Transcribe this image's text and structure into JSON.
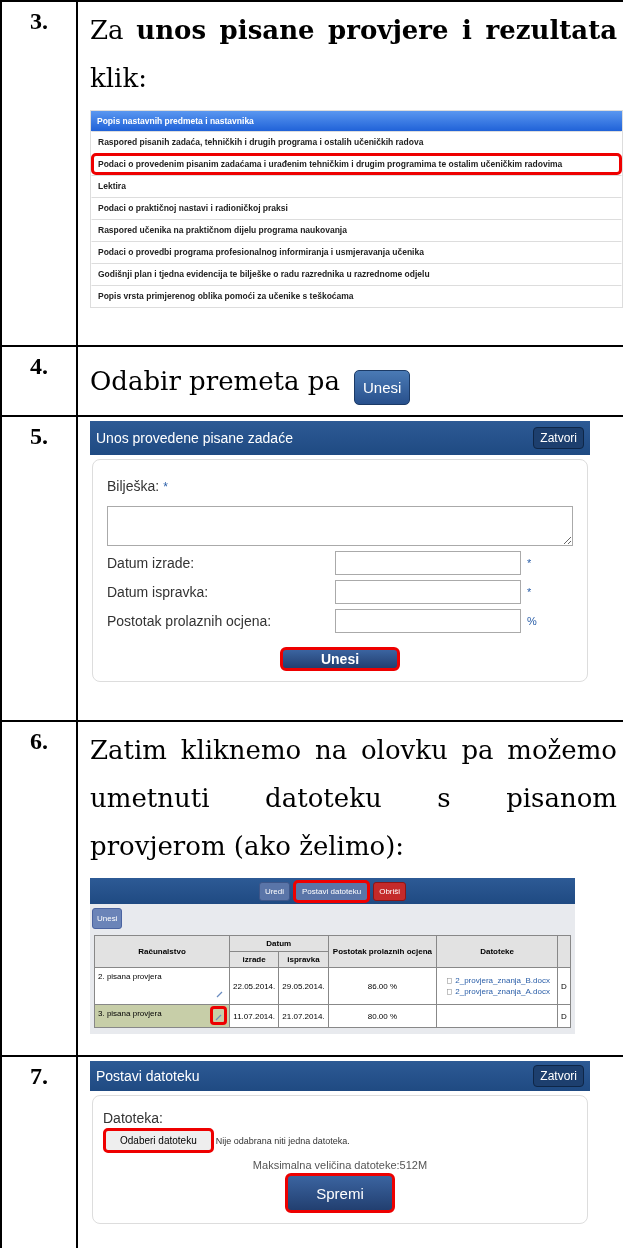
{
  "steps": [
    {
      "number": "3.",
      "kind": "menu",
      "text": "Za **unos pisane provjere i rezultata** klik:",
      "menu": {
        "header": "Popis nastavnih predmeta i nastavnika",
        "items": [
          {
            "label": "Raspored pisanih zadaća, tehničkih i drugih programa i ostalih učeničkih radova",
            "highlighted": false
          },
          {
            "label": "Podaci o provedenim pisanim zadaćama i urađenim tehničkim i drugim programima te ostalim učeničkim radovima",
            "highlighted": true
          },
          {
            "label": "Lektira",
            "highlighted": false
          },
          {
            "label": "Podaci o praktičnoj nastavi i radioničkoj praksi",
            "highlighted": false
          },
          {
            "label": "Raspored učenika na praktičnom dijelu programa naukovanja",
            "highlighted": false
          },
          {
            "label": "Podaci o provedbi programa profesionalnog informiranja i usmjeravanja učenika",
            "highlighted": false
          },
          {
            "label": "Godišnji plan i tjedna evidencija te bilješke o radu razrednika u razrednome odjelu",
            "highlighted": false
          },
          {
            "label": "Popis vrsta primjerenog oblika pomoći za učenike s teškoćama",
            "highlighted": false
          }
        ]
      }
    },
    {
      "number": "4.",
      "kind": "button",
      "text": "Odabir premeta pa",
      "button": "Unesi"
    },
    {
      "number": "5.",
      "kind": "form",
      "dialog": {
        "title": "Unos provedene pisane zadaće",
        "close": "Zatvori",
        "note_label": "Bilješka:",
        "note_mark": "*",
        "fields": [
          {
            "label": "Datum izrade:",
            "suffix": "*"
          },
          {
            "label": "Datum ispravka:",
            "suffix": "*"
          },
          {
            "label": "Postotak prolaznih ocjena:",
            "suffix": "%"
          }
        ],
        "submit": {
          "label": "Unesi",
          "highlighted": true
        }
      }
    },
    {
      "number": "6.",
      "kind": "grid",
      "text": "Zatim kliknemo na olovku pa možemo umetnuti datoteku s pisanom provjerom (ako želimo):",
      "toolbar": [
        {
          "label": "Uredi",
          "kind": "normal",
          "highlighted": false
        },
        {
          "label": "Postavi datoteku",
          "kind": "normal",
          "highlighted": true
        },
        {
          "label": "Obriši",
          "kind": "danger",
          "highlighted": false
        }
      ],
      "add_button": "Unesi",
      "table": {
        "columns": [
          "Računalstvo",
          "Datum",
          "Postotak prolaznih ocjena",
          "Datoteke"
        ],
        "subcolumns": [
          "izrade",
          "ispravka"
        ],
        "rows": [
          {
            "name": "2. pisana provjera",
            "created": "22.05.2014.",
            "corrected": "29.05.2014.",
            "percent": "86.00 %",
            "files": [
              "2_provjera_znanja_B.docx",
              "2_provjera_znanja_A.docx"
            ],
            "column_6": "D",
            "selected": false,
            "pencil_highlighted": false
          },
          {
            "name": "3. pisana provjera",
            "created": "11.07.2014.",
            "corrected": "21.07.2014.",
            "percent": "80.00 %",
            "files": [],
            "column_6": "D",
            "selected": true,
            "pencil_highlighted": true
          }
        ]
      }
    },
    {
      "number": "7.",
      "kind": "upload",
      "dialog": {
        "title": "Postavi datoteku",
        "close": "Zatvori",
        "file_label": "Datoteka:",
        "choose": {
          "label": "Odaberi datoteku",
          "highlighted": true
        },
        "no_file": "Nije odabrana niti jedna datoteka.",
        "max_size": "Maksimalna veličina datoteke:512M",
        "submit": {
          "label": "Spremi",
          "highlighted": true
        }
      }
    }
  ]
}
